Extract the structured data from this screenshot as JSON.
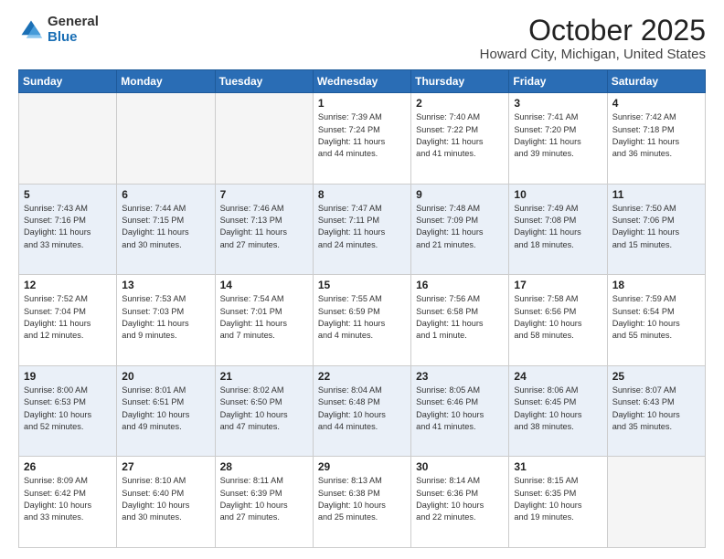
{
  "logo": {
    "general": "General",
    "blue": "Blue"
  },
  "header": {
    "month": "October 2025",
    "location": "Howard City, Michigan, United States"
  },
  "days_of_week": [
    "Sunday",
    "Monday",
    "Tuesday",
    "Wednesday",
    "Thursday",
    "Friday",
    "Saturday"
  ],
  "weeks": [
    [
      {
        "day": "",
        "info": ""
      },
      {
        "day": "",
        "info": ""
      },
      {
        "day": "",
        "info": ""
      },
      {
        "day": "1",
        "info": "Sunrise: 7:39 AM\nSunset: 7:24 PM\nDaylight: 11 hours\nand 44 minutes."
      },
      {
        "day": "2",
        "info": "Sunrise: 7:40 AM\nSunset: 7:22 PM\nDaylight: 11 hours\nand 41 minutes."
      },
      {
        "day": "3",
        "info": "Sunrise: 7:41 AM\nSunset: 7:20 PM\nDaylight: 11 hours\nand 39 minutes."
      },
      {
        "day": "4",
        "info": "Sunrise: 7:42 AM\nSunset: 7:18 PM\nDaylight: 11 hours\nand 36 minutes."
      }
    ],
    [
      {
        "day": "5",
        "info": "Sunrise: 7:43 AM\nSunset: 7:16 PM\nDaylight: 11 hours\nand 33 minutes."
      },
      {
        "day": "6",
        "info": "Sunrise: 7:44 AM\nSunset: 7:15 PM\nDaylight: 11 hours\nand 30 minutes."
      },
      {
        "day": "7",
        "info": "Sunrise: 7:46 AM\nSunset: 7:13 PM\nDaylight: 11 hours\nand 27 minutes."
      },
      {
        "day": "8",
        "info": "Sunrise: 7:47 AM\nSunset: 7:11 PM\nDaylight: 11 hours\nand 24 minutes."
      },
      {
        "day": "9",
        "info": "Sunrise: 7:48 AM\nSunset: 7:09 PM\nDaylight: 11 hours\nand 21 minutes."
      },
      {
        "day": "10",
        "info": "Sunrise: 7:49 AM\nSunset: 7:08 PM\nDaylight: 11 hours\nand 18 minutes."
      },
      {
        "day": "11",
        "info": "Sunrise: 7:50 AM\nSunset: 7:06 PM\nDaylight: 11 hours\nand 15 minutes."
      }
    ],
    [
      {
        "day": "12",
        "info": "Sunrise: 7:52 AM\nSunset: 7:04 PM\nDaylight: 11 hours\nand 12 minutes."
      },
      {
        "day": "13",
        "info": "Sunrise: 7:53 AM\nSunset: 7:03 PM\nDaylight: 11 hours\nand 9 minutes."
      },
      {
        "day": "14",
        "info": "Sunrise: 7:54 AM\nSunset: 7:01 PM\nDaylight: 11 hours\nand 7 minutes."
      },
      {
        "day": "15",
        "info": "Sunrise: 7:55 AM\nSunset: 6:59 PM\nDaylight: 11 hours\nand 4 minutes."
      },
      {
        "day": "16",
        "info": "Sunrise: 7:56 AM\nSunset: 6:58 PM\nDaylight: 11 hours\nand 1 minute."
      },
      {
        "day": "17",
        "info": "Sunrise: 7:58 AM\nSunset: 6:56 PM\nDaylight: 10 hours\nand 58 minutes."
      },
      {
        "day": "18",
        "info": "Sunrise: 7:59 AM\nSunset: 6:54 PM\nDaylight: 10 hours\nand 55 minutes."
      }
    ],
    [
      {
        "day": "19",
        "info": "Sunrise: 8:00 AM\nSunset: 6:53 PM\nDaylight: 10 hours\nand 52 minutes."
      },
      {
        "day": "20",
        "info": "Sunrise: 8:01 AM\nSunset: 6:51 PM\nDaylight: 10 hours\nand 49 minutes."
      },
      {
        "day": "21",
        "info": "Sunrise: 8:02 AM\nSunset: 6:50 PM\nDaylight: 10 hours\nand 47 minutes."
      },
      {
        "day": "22",
        "info": "Sunrise: 8:04 AM\nSunset: 6:48 PM\nDaylight: 10 hours\nand 44 minutes."
      },
      {
        "day": "23",
        "info": "Sunrise: 8:05 AM\nSunset: 6:46 PM\nDaylight: 10 hours\nand 41 minutes."
      },
      {
        "day": "24",
        "info": "Sunrise: 8:06 AM\nSunset: 6:45 PM\nDaylight: 10 hours\nand 38 minutes."
      },
      {
        "day": "25",
        "info": "Sunrise: 8:07 AM\nSunset: 6:43 PM\nDaylight: 10 hours\nand 35 minutes."
      }
    ],
    [
      {
        "day": "26",
        "info": "Sunrise: 8:09 AM\nSunset: 6:42 PM\nDaylight: 10 hours\nand 33 minutes."
      },
      {
        "day": "27",
        "info": "Sunrise: 8:10 AM\nSunset: 6:40 PM\nDaylight: 10 hours\nand 30 minutes."
      },
      {
        "day": "28",
        "info": "Sunrise: 8:11 AM\nSunset: 6:39 PM\nDaylight: 10 hours\nand 27 minutes."
      },
      {
        "day": "29",
        "info": "Sunrise: 8:13 AM\nSunset: 6:38 PM\nDaylight: 10 hours\nand 25 minutes."
      },
      {
        "day": "30",
        "info": "Sunrise: 8:14 AM\nSunset: 6:36 PM\nDaylight: 10 hours\nand 22 minutes."
      },
      {
        "day": "31",
        "info": "Sunrise: 8:15 AM\nSunset: 6:35 PM\nDaylight: 10 hours\nand 19 minutes."
      },
      {
        "day": "",
        "info": ""
      }
    ]
  ]
}
